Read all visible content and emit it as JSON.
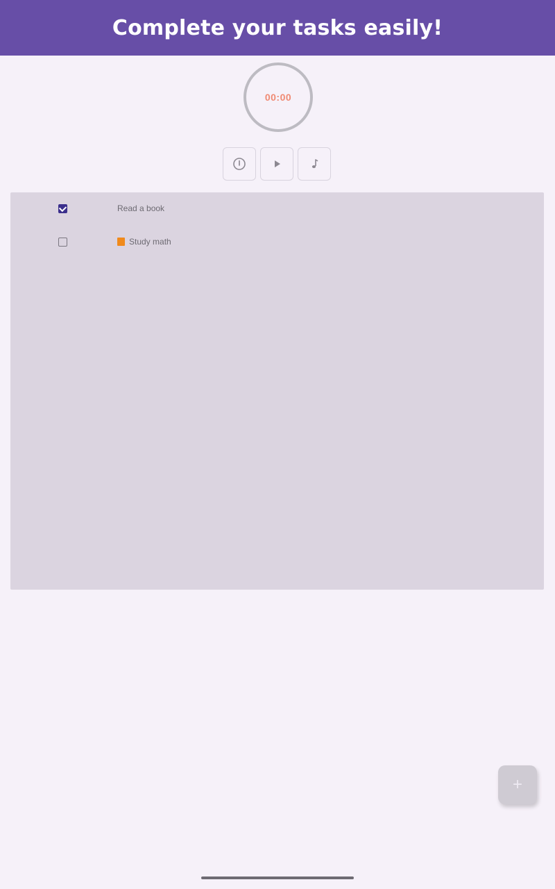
{
  "header": {
    "title": "Complete your tasks easily!",
    "color": "#674ea7"
  },
  "timer": {
    "display": "00:00",
    "text_color": "#f08a73"
  },
  "controls": [
    {
      "icon": "timer-icon"
    },
    {
      "icon": "play-icon"
    },
    {
      "icon": "music-note-icon"
    }
  ],
  "tasks": [
    {
      "label": "Read a book",
      "checked": true,
      "priority_color": null
    },
    {
      "label": "Study math",
      "checked": false,
      "priority_color": "#f08a1c"
    }
  ],
  "fab": {
    "icon": "plus-icon",
    "symbol": "+"
  }
}
